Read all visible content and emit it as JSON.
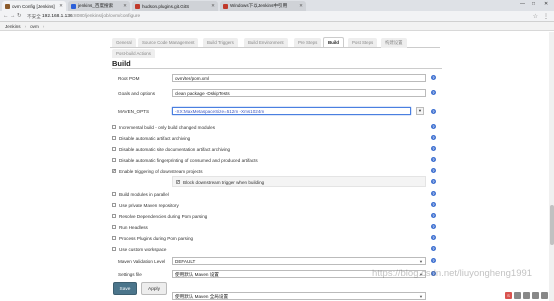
{
  "browser": {
    "tabs": [
      {
        "title": "ovm Config [Jenkins]",
        "active": true,
        "favicon_color": "#8b5a2b"
      },
      {
        "title": "jenkins_百度搜索",
        "active": false,
        "favicon_color": "#2b5fd9"
      },
      {
        "title": "hudson.plugins.git.GitS",
        "active": false,
        "favicon_color": "#c0392b"
      },
      {
        "title": "Windows下以Jenkins中引用",
        "active": false,
        "favicon_color": "#c0392b"
      }
    ],
    "window_controls": [
      "—",
      "□",
      "✕"
    ],
    "secure_label": "不安全",
    "url_host": "192.168.1.136",
    "url_rest": ":8080/jenkins/job/ovm/configure"
  },
  "breadcrumb": {
    "items": [
      "Jenkins",
      "ovm"
    ],
    "separator": "›"
  },
  "config_tabs": [
    {
      "label": "General",
      "active": false
    },
    {
      "label": "Source Code Management",
      "active": false
    },
    {
      "label": "Build Triggers",
      "active": false
    },
    {
      "label": "Build Environment",
      "active": false
    },
    {
      "label": "Pre Steps",
      "active": false
    },
    {
      "label": "Build",
      "active": true
    },
    {
      "label": "Post Steps",
      "active": false
    },
    {
      "label": "构建设置",
      "active": false
    },
    {
      "label": "Post-build Actions",
      "active": false
    }
  ],
  "build": {
    "title": "Build",
    "root_pom_label": "Root POM",
    "root_pom_value": "ovm/ter/pom.xml",
    "goals_label": "Goals and options",
    "goals_value": "clean package -DskipTests",
    "maven_opts_label": "MAVEN_OPTS",
    "maven_opts_value": "-XX:MaxMetaspaceSize=512m -Xms1024m",
    "maven_opts_button": "▼",
    "options": [
      {
        "label": "Incremental build - only build changed modules",
        "checked": false
      },
      {
        "label": "Disable automatic artifact archiving",
        "checked": false
      },
      {
        "label": "Disable automatic site documentation artifact archiving",
        "checked": false
      },
      {
        "label": "Disable automatic fingerprinting of consumed and produced artifacts",
        "checked": false
      },
      {
        "label": "Enable triggering of downstream projects",
        "checked": true
      }
    ],
    "sub_option": {
      "label": "Block downstream trigger when building",
      "checked": true
    },
    "options2": [
      {
        "label": "Build modules in parallel",
        "checked": false
      },
      {
        "label": "Use private Maven repository",
        "checked": false
      },
      {
        "label": "Resolve Dependencies during Pom parsing",
        "checked": false
      },
      {
        "label": "Run Headless",
        "checked": false
      },
      {
        "label": "Process Plugins during Pom parsing",
        "checked": false
      },
      {
        "label": "Use custom workspace",
        "checked": false
      }
    ],
    "validation_label": "Maven Validation Level",
    "validation_value": "DEFAULT",
    "settings_label": "Settings file",
    "settings_value": "使用默认 Maven 设置",
    "global_settings_value": "使用默认 Maven 全局设置"
  },
  "actions": {
    "save_label": "Save",
    "apply_label": "Apply"
  },
  "watermark": "https://blog.csdn.net/liuyongheng1991",
  "colors": {
    "save_bg": "#4b758b",
    "help_icon": "#3d6fd0",
    "focus_border": "#4a7fe0"
  }
}
